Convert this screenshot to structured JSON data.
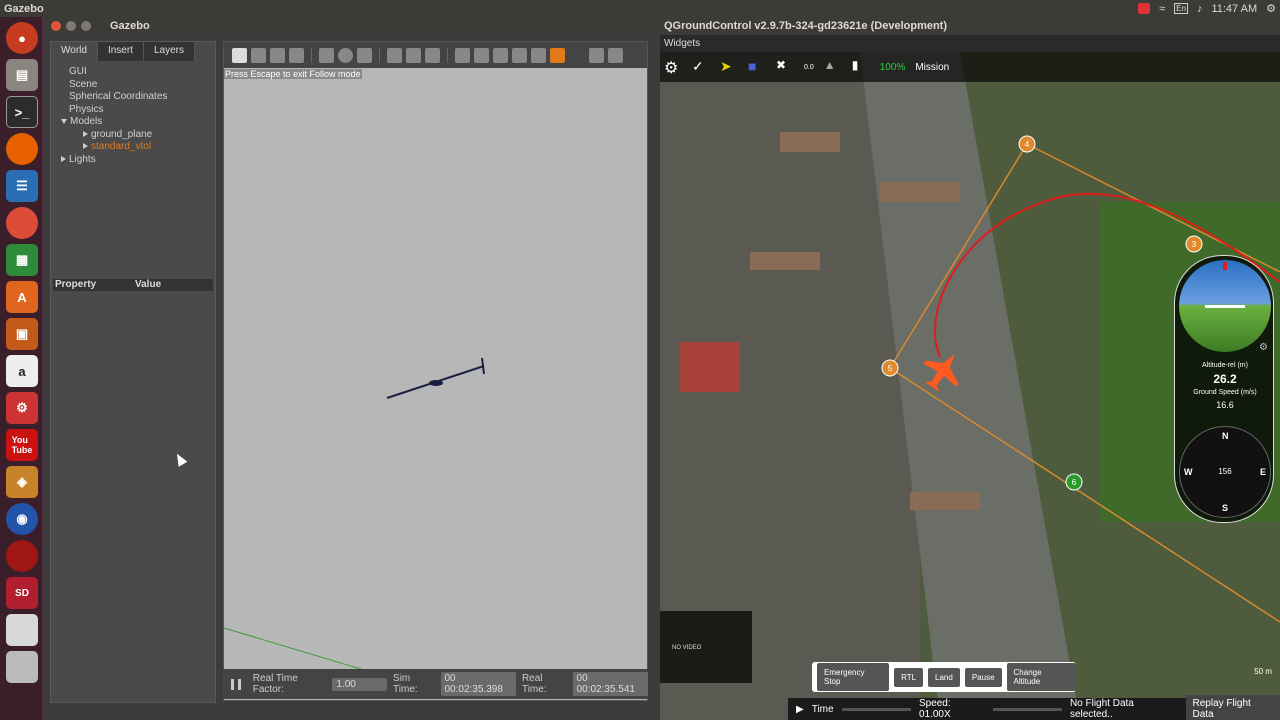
{
  "topbar": {
    "app_name": "Gazebo",
    "time": "11:47 AM",
    "lang": "En"
  },
  "launcher": {
    "items": [
      "ubuntu-icon",
      "files-icon",
      "terminal-icon",
      "firefox-icon",
      "writer-icon",
      "chrome-icon",
      "calc-icon",
      "software-icon",
      "impress-icon",
      "amazon-icon",
      "settings-icon",
      "youtube-icon",
      "box-icon",
      "camera-icon",
      "record-icon",
      "sd-icon",
      "drive-icon",
      "stack-icon"
    ]
  },
  "gazebo": {
    "title": "Gazebo",
    "tabs": [
      "World",
      "Insert",
      "Layers"
    ],
    "tree": {
      "gui": "GUI",
      "scene": "Scene",
      "spherical": "Spherical Coordinates",
      "physics": "Physics",
      "models": "Models",
      "ground_plane": "ground_plane",
      "standard_vtol": "standard_vtol",
      "lights": "Lights"
    },
    "prop_header": {
      "property": "Property",
      "value": "Value"
    },
    "hint": "Press Escape to exit Follow mode",
    "bottom": {
      "rtf_label": "Real Time Factor:",
      "rtf_value": "1.00",
      "sim_label": "Sim Time:",
      "sim_value": "00 00:02:35.398",
      "real_label": "Real Time:",
      "real_value": "00 00:02:35.541"
    }
  },
  "qgc": {
    "title": "QGroundControl v2.9.7b-324-gd23621e (Development)",
    "menu": "Widgets",
    "toolbar": {
      "battery": "100%",
      "mode": "Mission",
      "sats": "0.0"
    },
    "waypoints": [
      "4",
      "3",
      "5",
      "6"
    ],
    "instrument": {
      "alt_label": "Altitude-rel (m)",
      "alt_value": "26.2",
      "gs_label": "Ground Speed (m/s)",
      "gs_value": "16.6",
      "heading": "156",
      "compass": {
        "n": "N",
        "e": "E",
        "s": "S",
        "w": "W"
      }
    },
    "actions": [
      "Emergency Stop",
      "RTL",
      "Land",
      "Pause",
      "Change Altitude"
    ],
    "video": "NO VIDEO",
    "replay": {
      "time_label": "Time",
      "speed": "Speed: 01.00X",
      "status": "No Flight Data selected..",
      "button": "Replay Flight Data"
    },
    "scale": "50 m"
  }
}
